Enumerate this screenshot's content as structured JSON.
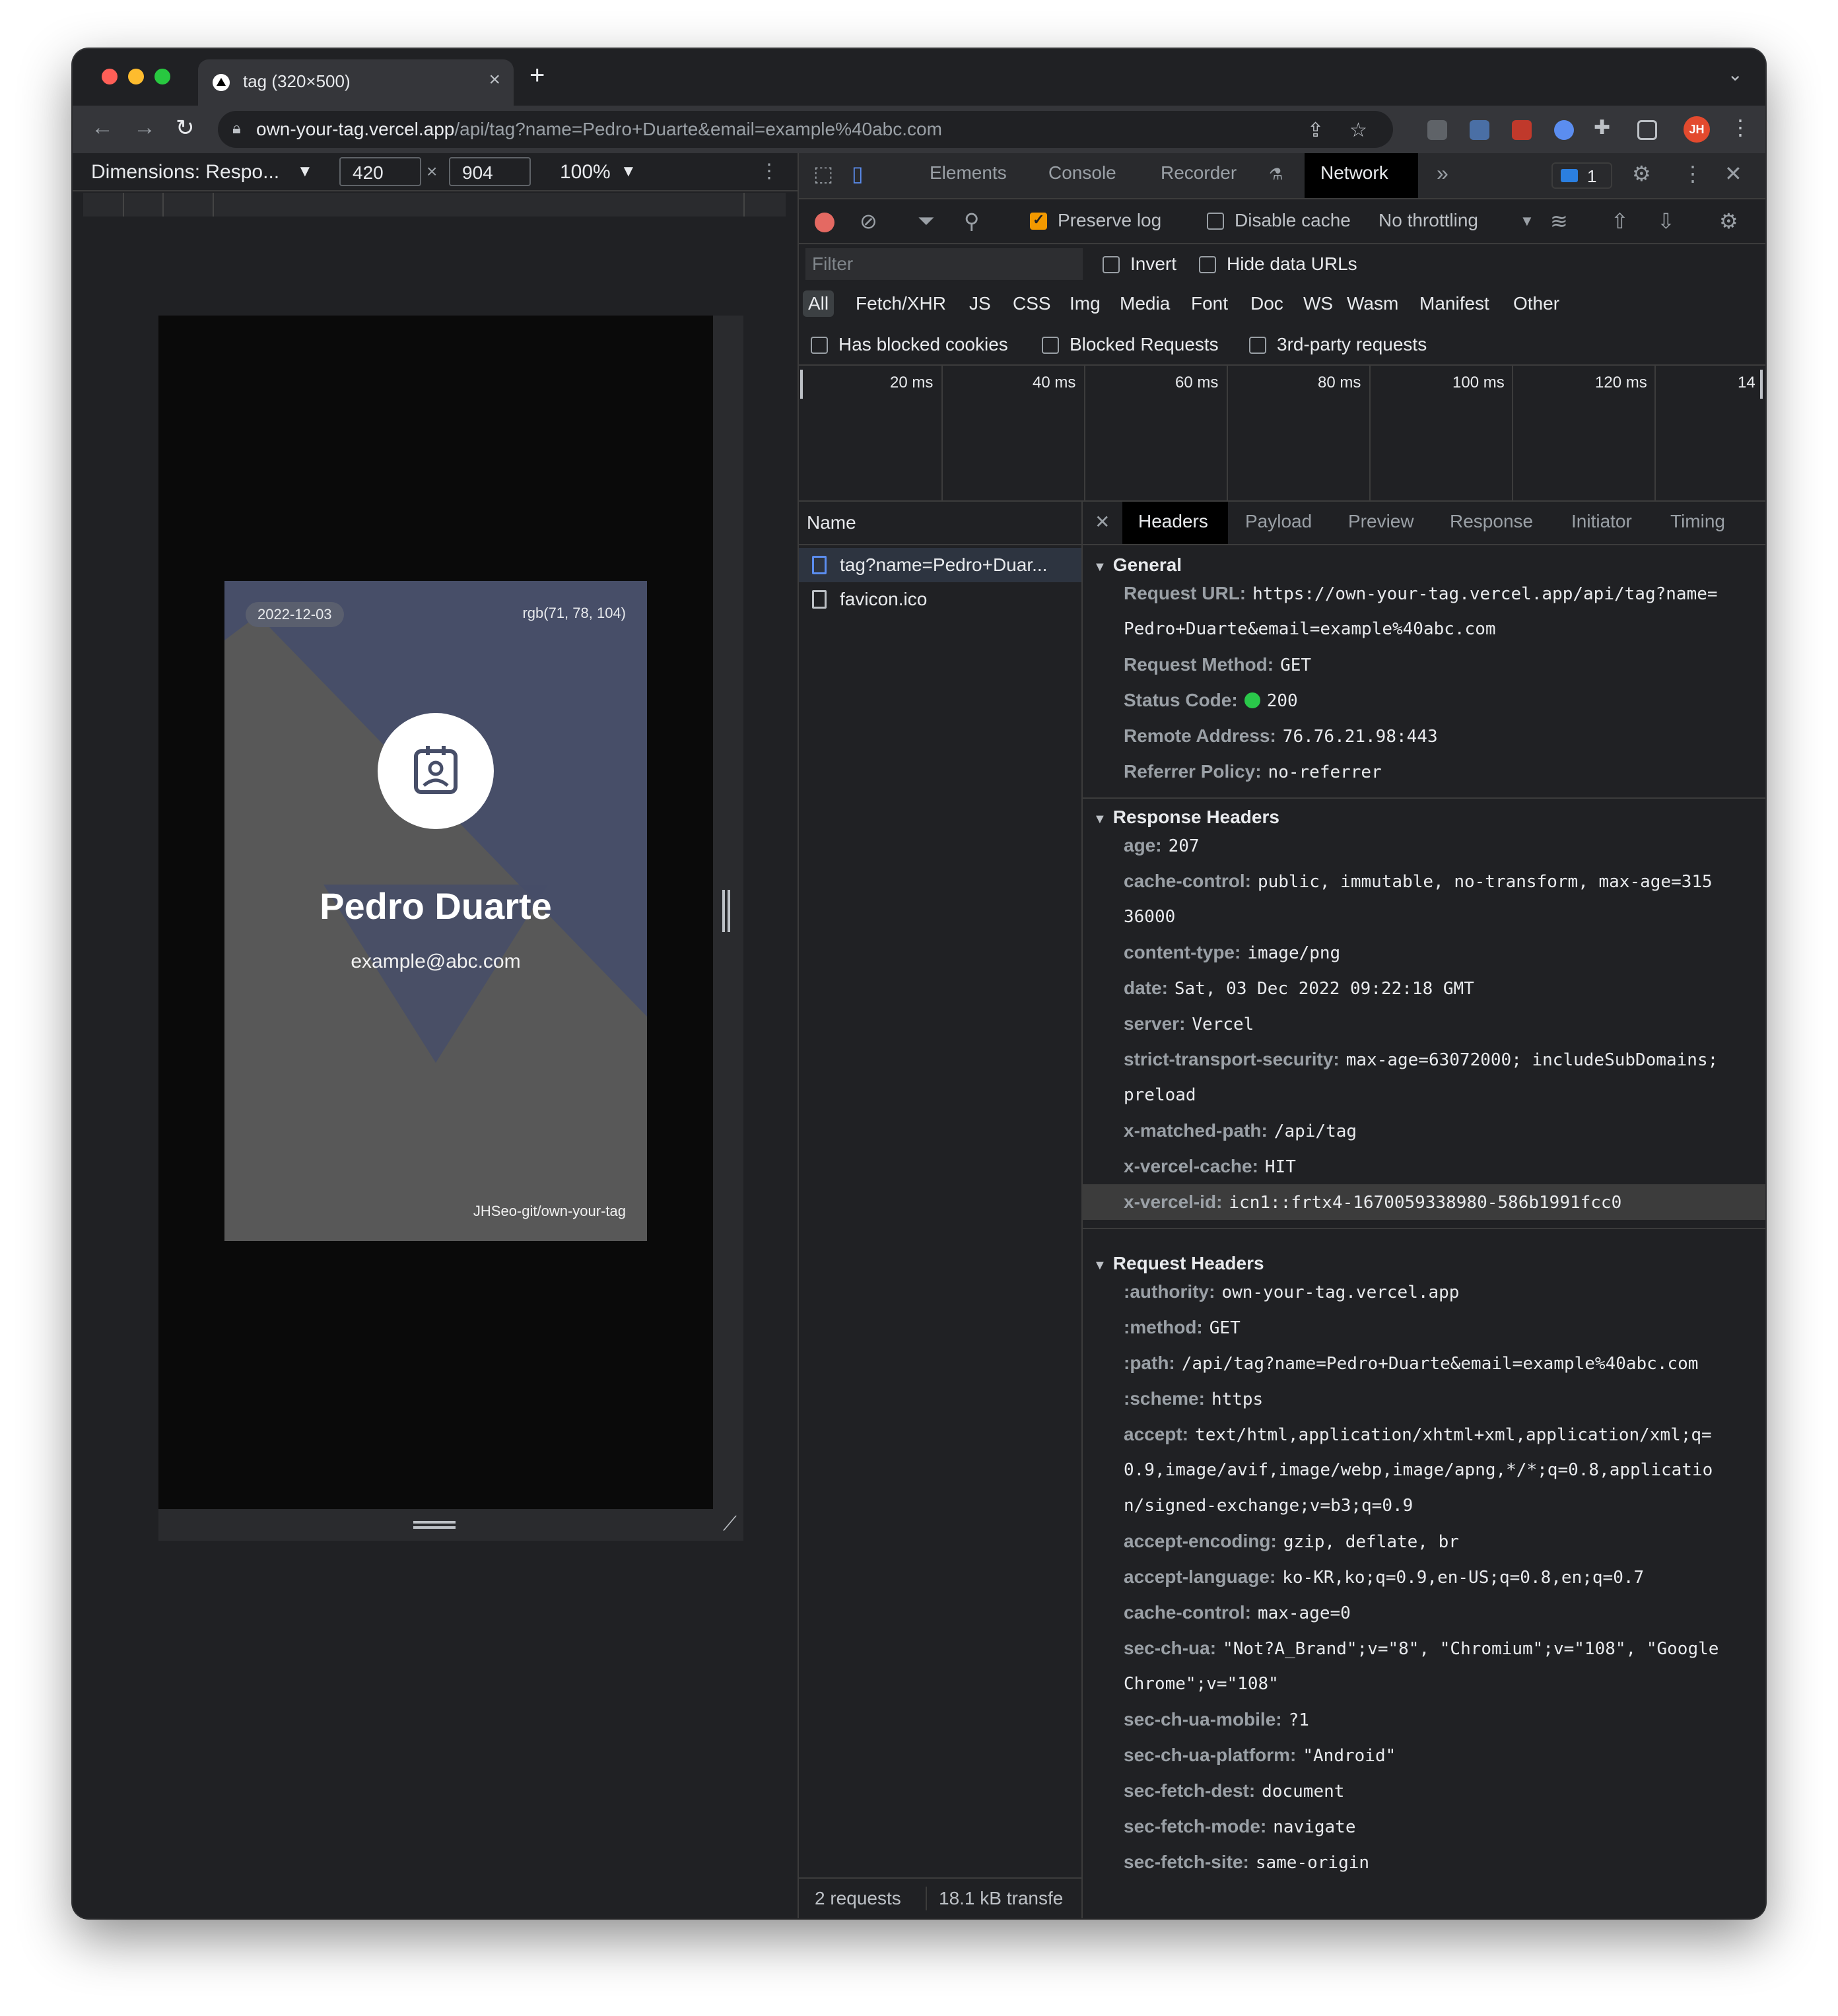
{
  "browser": {
    "tab_title": "tag (320×500)",
    "tab_close": "×",
    "new_tab": "+",
    "tab_menu": "⌄",
    "url_host": "own-your-tag.vercel.app",
    "url_path": "/api/tag?name=Pedro+Duarte&email=example%40abc.com",
    "avatar_initials": "JH"
  },
  "device_toolbar": {
    "dimensions_label": "Dimensions: Respo...",
    "width": "420",
    "height": "904",
    "times": "×",
    "zoom": "100%"
  },
  "card": {
    "date": "2022-12-03",
    "color_label": "rgb(71, 78, 104)",
    "name": "Pedro Duarte",
    "email": "example@abc.com",
    "repo": "JHSeo-git/own-your-tag",
    "colors": {
      "accent": "#474e68",
      "base": "#585858"
    }
  },
  "devtools": {
    "panels": [
      "Elements",
      "Console",
      "Recorder",
      "Network"
    ],
    "active_panel": "Network",
    "issues_count": "1",
    "network_toolbar": {
      "preserve_log": "Preserve log",
      "preserve_log_checked": true,
      "disable_cache": "Disable cache",
      "throttling": "No throttling"
    },
    "filter": {
      "placeholder": "Filter",
      "invert": "Invert",
      "hide_data_urls": "Hide data URLs"
    },
    "types": [
      "All",
      "Fetch/XHR",
      "JS",
      "CSS",
      "Img",
      "Media",
      "Font",
      "Doc",
      "WS",
      "Wasm",
      "Manifest",
      "Other"
    ],
    "blocked": {
      "has_blocked_cookies": "Has blocked cookies",
      "blocked_requests": "Blocked Requests",
      "third_party": "3rd-party requests"
    },
    "timeline_ticks": [
      "20 ms",
      "40 ms",
      "60 ms",
      "80 ms",
      "100 ms",
      "120 ms",
      "14"
    ],
    "requests_header": "Name",
    "requests": [
      {
        "name": "tag?name=Pedro+Duar..."
      },
      {
        "name": "favicon.ico"
      }
    ],
    "status": {
      "count": "2 requests",
      "transferred": "18.1 kB transfe"
    },
    "detail_tabs": [
      "Headers",
      "Payload",
      "Preview",
      "Response",
      "Initiator",
      "Timing"
    ],
    "general": {
      "title": "General",
      "request_url_key": "Request URL:",
      "request_url_1": "https://own-your-tag.vercel.app/api/tag?name=",
      "request_url_2": "Pedro+Duarte&email=example%40abc.com",
      "method_key": "Request Method:",
      "method": "GET",
      "status_key": "Status Code:",
      "status": "200",
      "remote_key": "Remote Address:",
      "remote": "76.76.21.98:443",
      "referrer_key": "Referrer Policy:",
      "referrer": "no-referrer"
    },
    "response_headers": {
      "title": "Response Headers",
      "age_k": "age:",
      "age_v": "207",
      "cc_k": "cache-control:",
      "cc_v1": "public, immutable, no-transform, max-age=315",
      "cc_v2": "36000",
      "ct_k": "content-type:",
      "ct_v": "image/png",
      "date_k": "date:",
      "date_v": "Sat, 03 Dec 2022 09:22:18 GMT",
      "server_k": "server:",
      "server_v": "Vercel",
      "sts_k": "strict-transport-security:",
      "sts_v1": "max-age=63072000; includeSubDomains;",
      "sts_v2": "preload",
      "xmp_k": "x-matched-path:",
      "xmp_v": "/api/tag",
      "xvc_k": "x-vercel-cache:",
      "xvc_v": "HIT",
      "xvi_k": "x-vercel-id:",
      "xvi_v": "icn1::frtx4-1670059338980-586b1991fcc0"
    },
    "request_headers": {
      "title": "Request Headers",
      "auth_k": ":authority:",
      "auth_v": "own-your-tag.vercel.app",
      "method_k": ":method:",
      "method_v": "GET",
      "path_k": ":path:",
      "path_v": "/api/tag?name=Pedro+Duarte&email=example%40abc.com",
      "scheme_k": ":scheme:",
      "scheme_v": "https",
      "accept_k": "accept:",
      "accept_v1": "text/html,application/xhtml+xml,application/xml;q=",
      "accept_v2": "0.9,image/avif,image/webp,image/apng,*/*;q=0.8,applicatio",
      "accept_v3": "n/signed-exchange;v=b3;q=0.9",
      "ae_k": "accept-encoding:",
      "ae_v": "gzip, deflate, br",
      "al_k": "accept-language:",
      "al_v": "ko-KR,ko;q=0.9,en-US;q=0.8,en;q=0.7",
      "cc_k": "cache-control:",
      "cc_v": "max-age=0",
      "ua_k": "sec-ch-ua:",
      "ua_v1": "\"Not?A_Brand\";v=\"8\", \"Chromium\";v=\"108\", \"Google",
      "ua_v2": "Chrome\";v=\"108\"",
      "uam_k": "sec-ch-ua-mobile:",
      "uam_v": "?1",
      "uap_k": "sec-ch-ua-platform:",
      "uap_v": "\"Android\"",
      "sfd_k": "sec-fetch-dest:",
      "sfd_v": "document",
      "sfm_k": "sec-fetch-mode:",
      "sfm_v": "navigate",
      "sfs_k": "sec-fetch-site:",
      "sfs_v": "same-origin"
    }
  }
}
